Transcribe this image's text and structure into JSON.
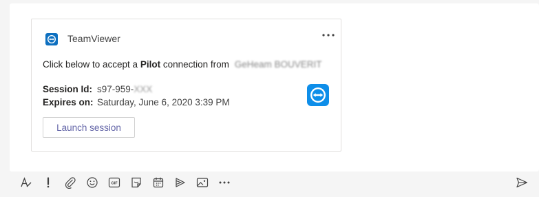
{
  "card": {
    "app_name": "TeamViewer",
    "message_prefix": "Click below to accept a",
    "message_bold": "Pilot",
    "message_middle": "connection from",
    "redacted_name": "GeHeam BOUVERIT",
    "facts": [
      {
        "key": "Session Id:",
        "value": "s97-959-",
        "redacted_suffix": "XXX"
      },
      {
        "key": "Expires on:",
        "value": "Saturday, June 6, 2020 3:39 PM"
      }
    ],
    "launch_label": "Launch session",
    "more_label": "•••"
  },
  "toolbar": {
    "items": [
      "format-icon",
      "important-icon",
      "attach-icon",
      "emoji-icon",
      "gif-icon",
      "sticker-icon",
      "schedule-meeting-icon",
      "stream-icon",
      "image-icon",
      "more-options-icon"
    ],
    "gif_text": "GIF"
  },
  "colors": {
    "accent": "#6264a7",
    "teamviewer_blue": "#0e8ee9"
  }
}
